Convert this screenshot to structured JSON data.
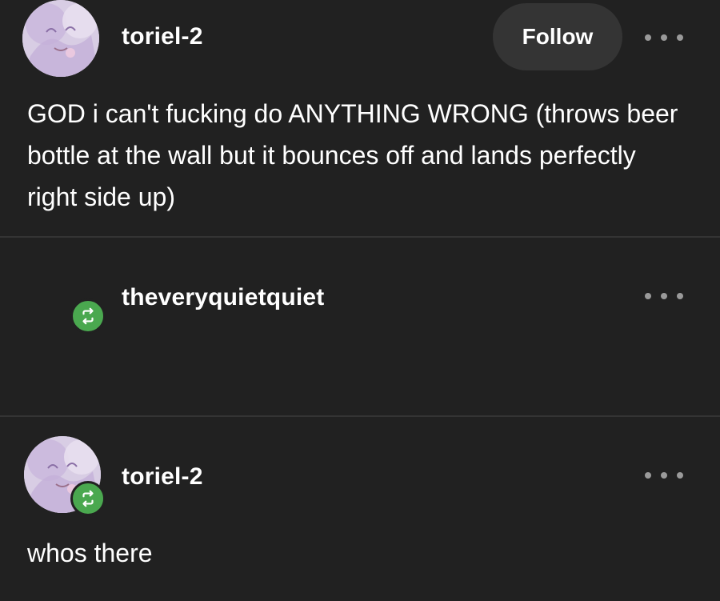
{
  "post": {
    "author": "toriel-2",
    "follow_label": "Follow",
    "body": "GOD i can't fucking do ANYTHING WRONG (throws beer bottle at the wall but it bounces off and lands perfectly right side up)"
  },
  "reblogs": [
    {
      "author": "theveryquietquiet",
      "body": ""
    },
    {
      "author": "toriel-2",
      "body": "whos there"
    }
  ],
  "colors": {
    "background": "#212121",
    "divider": "#343434",
    "button": "#343434",
    "reblog_green": "#4aa84f",
    "text": "#ffffff",
    "more_dots": "#9a9a9a"
  },
  "icons": {
    "more": "more-horizontal-icon",
    "reblog": "reblog-icon",
    "avatar": "avatar-image"
  }
}
